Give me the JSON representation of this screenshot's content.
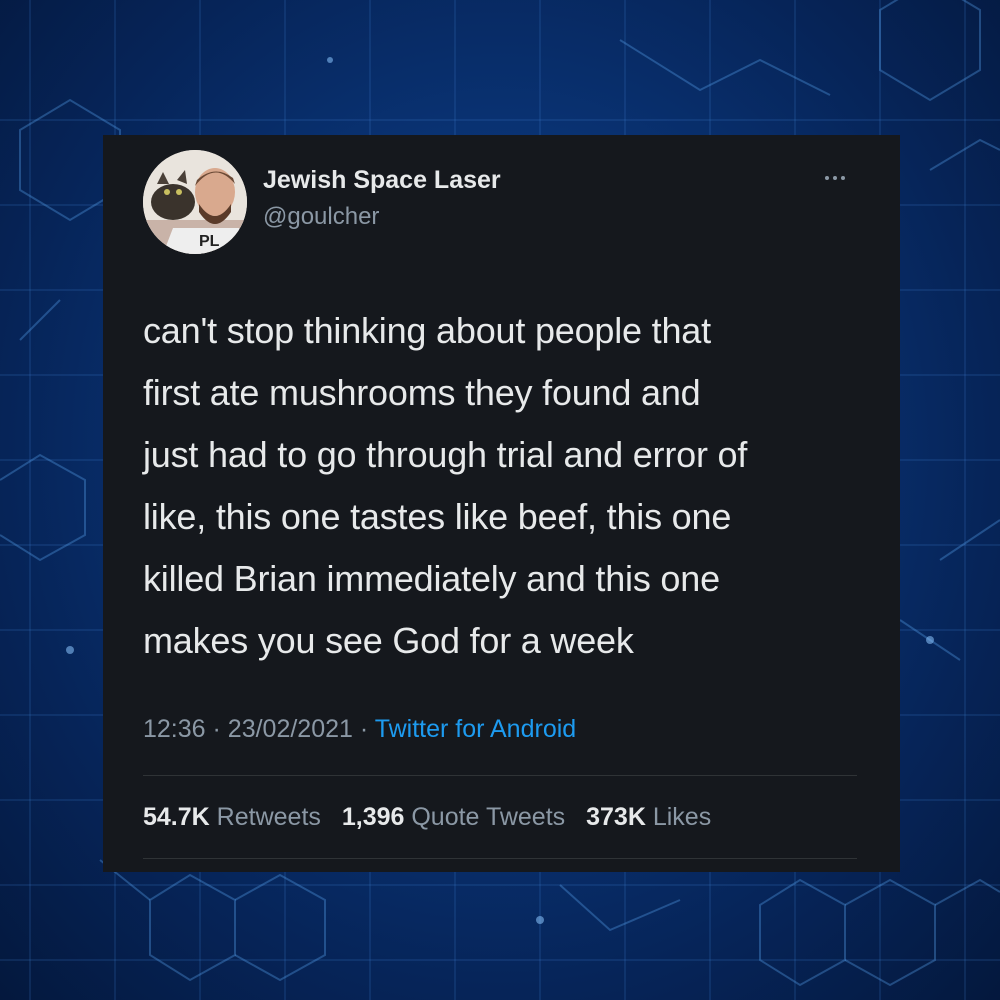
{
  "tweet": {
    "display_name": "Jewish Space Laser",
    "handle": "@goulcher",
    "avatar_icon": "user-avatar-photo",
    "more_icon": "more-options-icon",
    "text_lines": [
      "can't stop thinking about people that",
      "first ate mushrooms they found and",
      "just had to go through trial and error of",
      "like, this one tastes like beef, this one",
      "killed Brian immediately and this one",
      "makes you see God for a week"
    ],
    "time": "12:36",
    "date": "23/02/2021",
    "separator": "·",
    "source": "Twitter for Android",
    "stats": {
      "retweets_count": "54.7K",
      "retweets_label": "Retweets",
      "quotes_count": "1,396",
      "quotes_label": "Quote Tweets",
      "likes_count": "373K",
      "likes_label": "Likes"
    }
  },
  "colors": {
    "card_bg": "#15181d",
    "text_primary": "#e7e9ea",
    "text_secondary": "#8b98a5",
    "link": "#1d9bf0",
    "background": "#0a3578"
  }
}
